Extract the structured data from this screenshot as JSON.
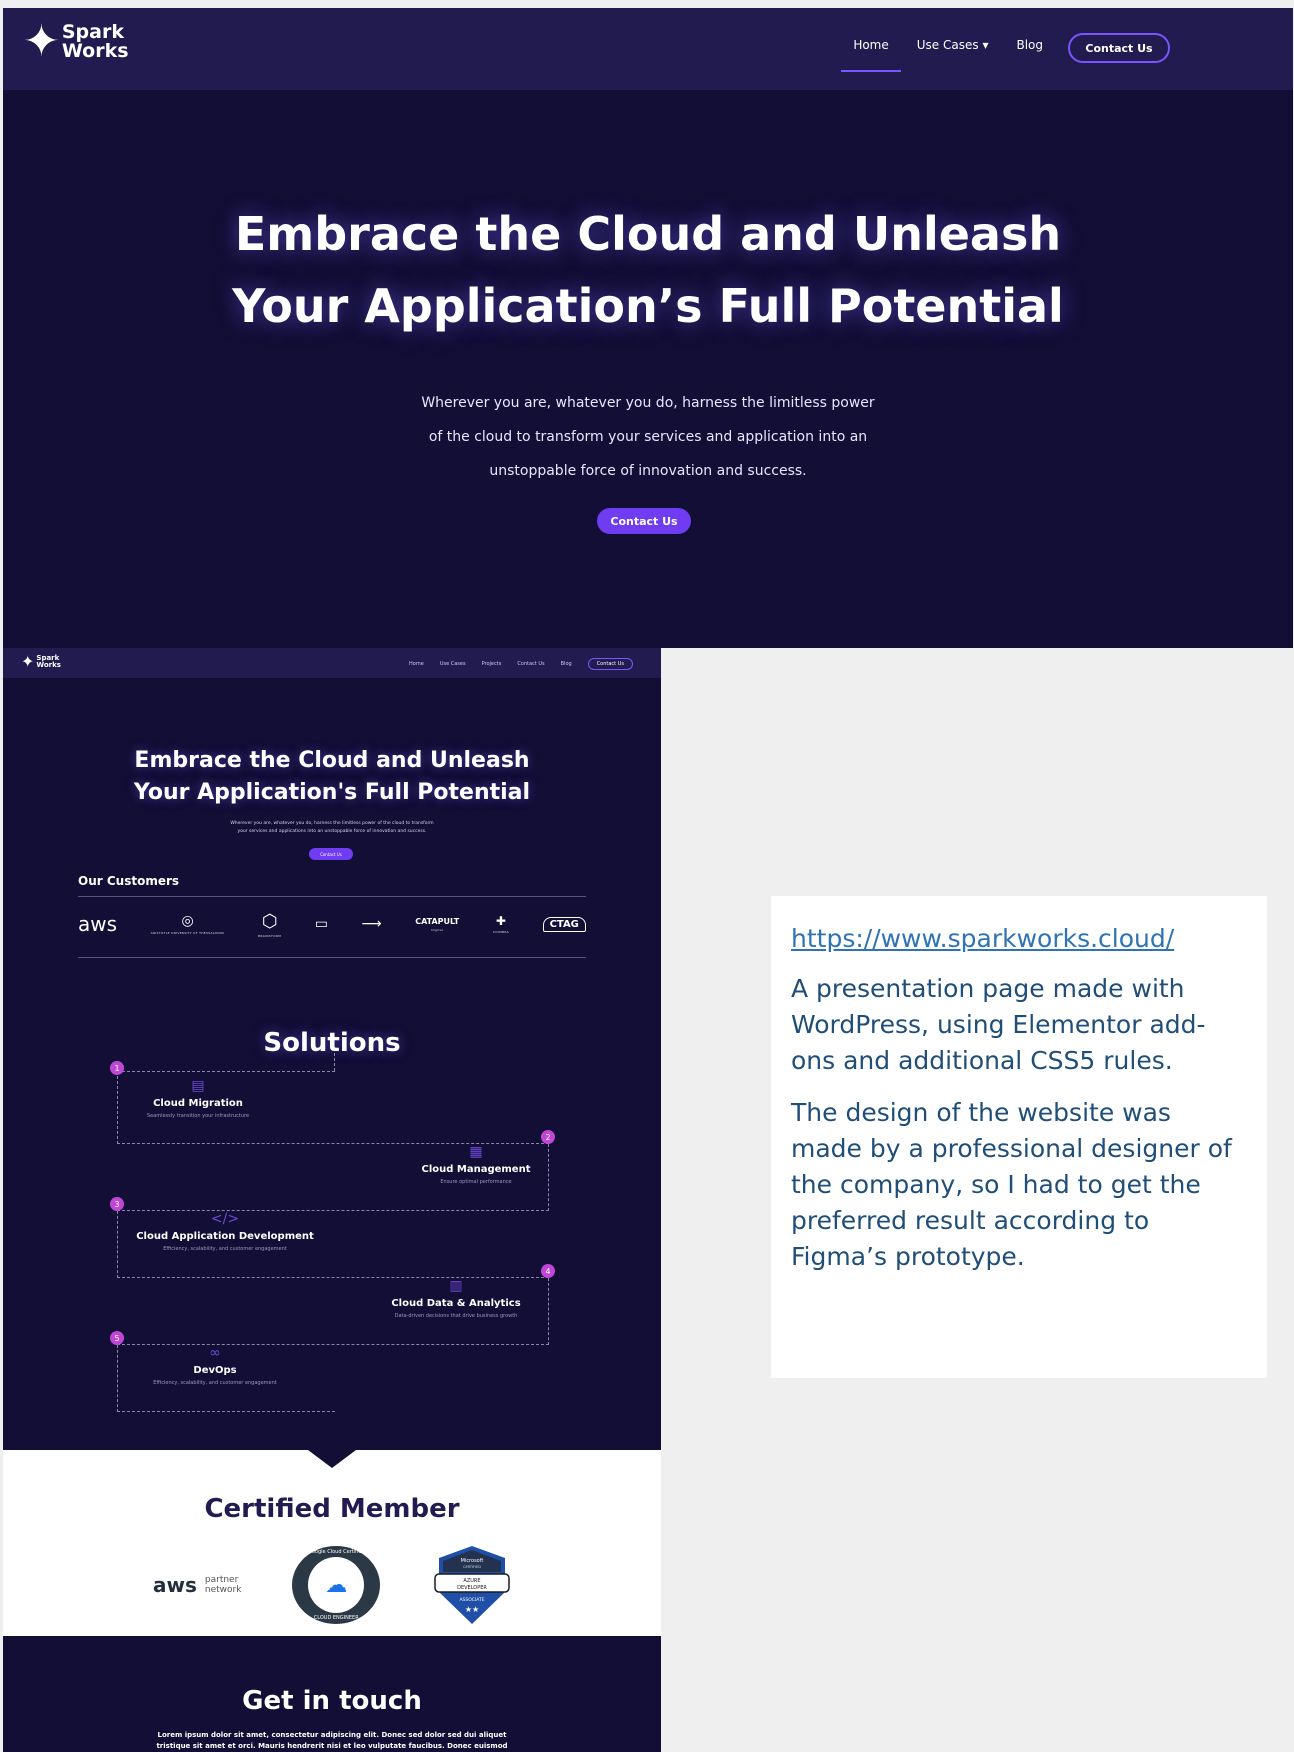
{
  "brand": {
    "line1": "Spark",
    "line2": "Works"
  },
  "hero": {
    "nav": {
      "home": "Home",
      "use_cases": "Use  Cases",
      "blog": "Blog",
      "contact": "Contact Us"
    },
    "title_line1": "Embrace the Cloud and Unleash",
    "title_line2": "Your Application’s Full Potential",
    "sub_line1": "Wherever you are, whatever you do, harness the limitless power",
    "sub_line2": "of the cloud to transform your services and application into an",
    "sub_line3": "unstoppable force of innovation and success.",
    "button": "Contact Us"
  },
  "full": {
    "nav": {
      "home": "Home",
      "use_cases": "Use Cases",
      "projects": "Projects",
      "contact": "Contact Us",
      "blog": "Blog",
      "cta": "Contact Us"
    },
    "title_line1": "Embrace the Cloud and Unleash",
    "title_line2": "Your Application's Full Potential",
    "sub_line1": "Wherever you are, whatever you do, harness the limitless power of the cloud to transform",
    "sub_line2": "your services and applications into an unstoppable force of innovation and success.",
    "button": "Contact Us",
    "customers_heading": "Our Customers",
    "customers": [
      {
        "mark": "aws",
        "cap": ""
      },
      {
        "mark": "◎",
        "cap": "ARISTOTLE UNIVERSITY OF THESSALONIKI"
      },
      {
        "mark": "⬡",
        "cap": "BRAINSTORM"
      },
      {
        "mark": "▭",
        "cap": ""
      },
      {
        "mark": "⟶",
        "cap": ""
      },
      {
        "mark": "CATAPULT",
        "cap": "Digital"
      },
      {
        "mark": "✚",
        "cap": "COIMBRA"
      },
      {
        "mark": "CTAG",
        "cap": ""
      }
    ],
    "solutions_heading": "Solutions",
    "solutions": [
      {
        "num": "1",
        "name": "Cloud Migration",
        "desc": "Seamlessly transition your infrastructure",
        "icon": "server-icon"
      },
      {
        "num": "2",
        "name": "Cloud Management",
        "desc": "Ensure optimal performance",
        "icon": "grid-icon"
      },
      {
        "num": "3",
        "name": "Cloud Application Development",
        "desc": "Efficiency, scalability, and customer engagement",
        "icon": "code-icon"
      },
      {
        "num": "4",
        "name": "Cloud Data & Analytics",
        "desc": "Data-driven decisions that drive business growth",
        "icon": "database-icon"
      },
      {
        "num": "5",
        "name": "DevOps",
        "desc": "Efficiency, scalability, and customer engagement",
        "icon": "infinity-icon"
      }
    ],
    "certified_heading": "Certified Member",
    "aws_partner": {
      "a": "aws",
      "b1": "partner",
      "b2": "network"
    },
    "google_badge": {
      "top": "Google Cloud Certified",
      "bottom": "CLOUD ENGINEER"
    },
    "ms_badge": {
      "l1": "Microsoft",
      "l2": "CERTIFIED",
      "l3": "AZURE",
      "l4": "DEVELOPER",
      "l5": "ASSOCIATE"
    },
    "git_heading": "Get in touch",
    "git_text": "Lorem ipsum dolor sit amet, consectetur adipiscing elit. Donec sed dolor sed dui aliquet tristique sit amet et orci. Mauris hendrerit nisi et leo vulputate faucibus. Donec euismod elit lacus, a ullamcorper urna aliquet fringilla. Pellentesque habitant morbi"
  },
  "description": {
    "link": "https://www.sparkworks.cloud/",
    "p1": "A presentation page made with WordPress, using Elementor add-ons and additional CSS5 rules.",
    "p2": "The design of the website was made by a professional designer of the company, so I had to get the preferred result according to Figma’s prototype."
  },
  "colors": {
    "navy": "#120e35",
    "nav": "#211b4f",
    "accent": "#6f3cf2",
    "pink": "#c046d6"
  }
}
